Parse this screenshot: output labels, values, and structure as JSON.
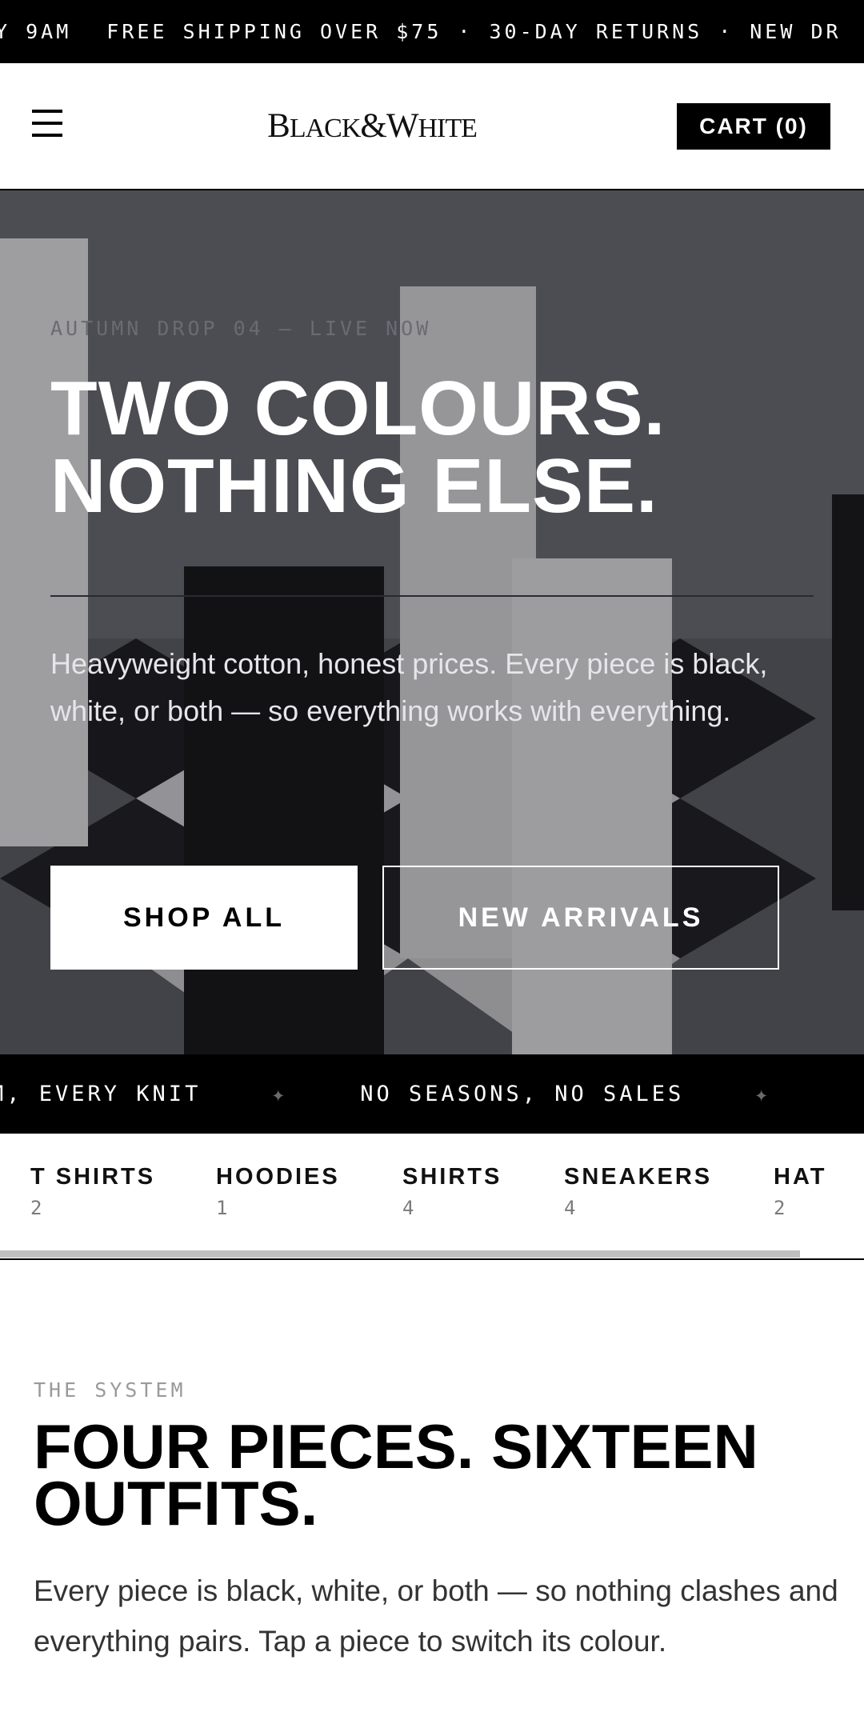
{
  "announcement": {
    "segments": [
      "Y 9AM",
      "FREE SHIPPING OVER $75",
      "30-DAY RETURNS",
      "NEW DR"
    ],
    "separator": "·"
  },
  "header": {
    "logo_parts": [
      "B",
      "LACK",
      "&",
      "W",
      "HITE"
    ],
    "cart_label": "CART (0)"
  },
  "hero": {
    "eyebrow": "AUTUMN DROP 04 — LIVE NOW",
    "title_line1": "TWO COLOURS.",
    "title_line2": "NOTHING ELSE.",
    "text": "Heavyweight cotton, honest prices. Every piece is black, white, or both — so everything works with everything.",
    "primary_button": "SHOP ALL",
    "secondary_button": "NEW ARRIVALS"
  },
  "marquee": {
    "items": [
      "M, EVERY KNIT",
      "NO SEASONS, NO SALES"
    ],
    "star": "✦"
  },
  "categories": [
    {
      "label": "T SHIRTS",
      "count": "2"
    },
    {
      "label": "HOODIES",
      "count": "1"
    },
    {
      "label": "SHIRTS",
      "count": "4"
    },
    {
      "label": "SNEAKERS",
      "count": "4"
    },
    {
      "label": "HAT",
      "count": "2"
    }
  ],
  "system": {
    "eyebrow": "THE SYSTEM",
    "title": "FOUR PIECES. SIXTEEN OUTFITS.",
    "text": "Every piece is black, white, or both — so nothing clashes and everything pairs. Tap a piece to switch its colour."
  },
  "colors": {
    "black": "#000000",
    "white": "#ffffff",
    "hero_overlay": "#4a4b52"
  },
  "icons": [
    "hamburger-menu-icon",
    "star-separator-icon"
  ]
}
